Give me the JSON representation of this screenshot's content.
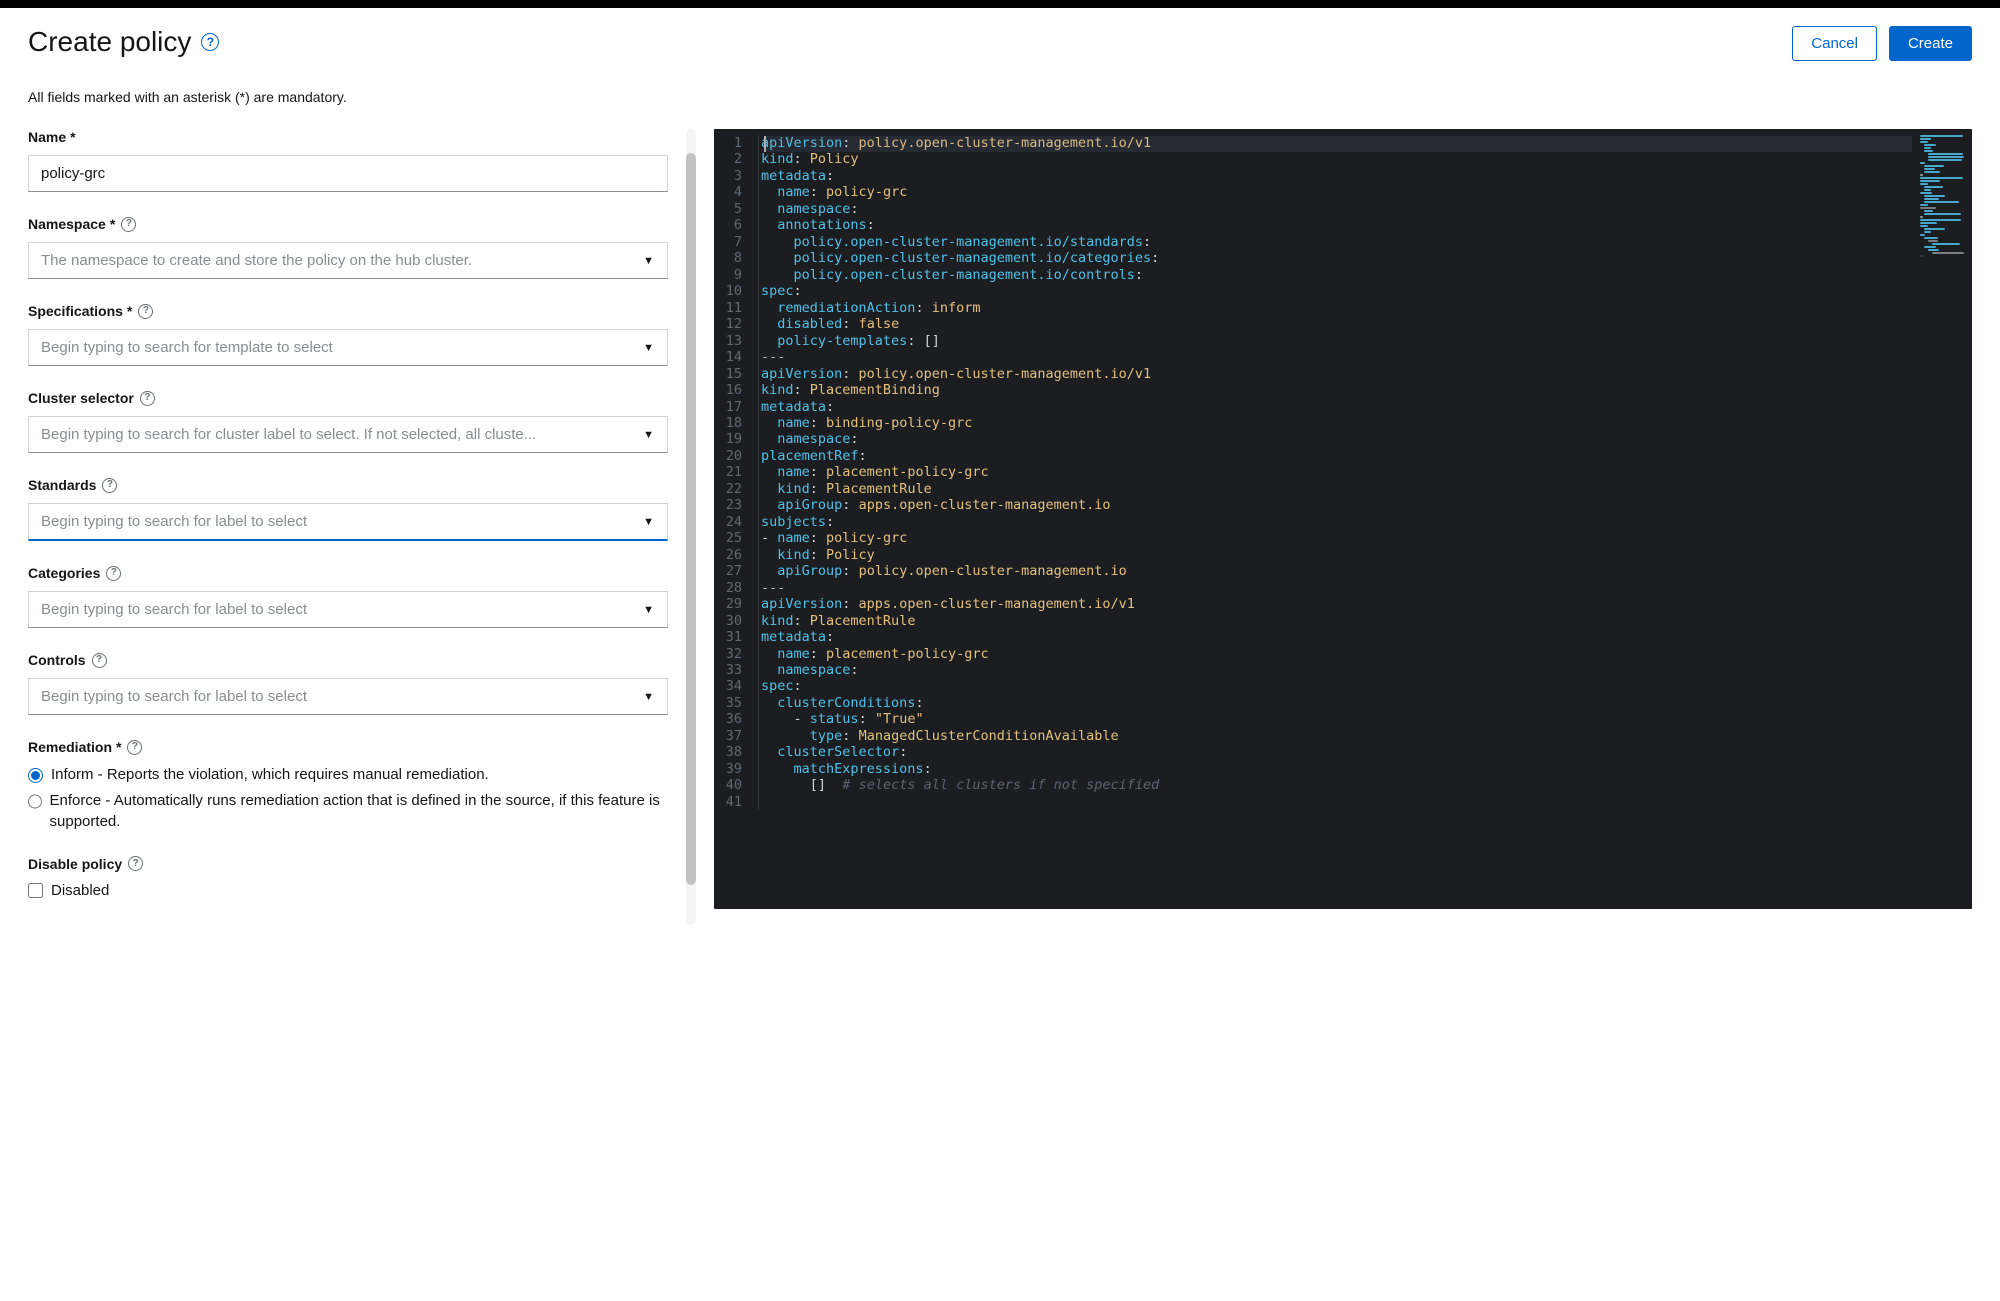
{
  "header": {
    "title": "Create policy",
    "cancel_label": "Cancel",
    "create_label": "Create",
    "mandatory_note": "All fields marked with an asterisk (*) are mandatory."
  },
  "form": {
    "name": {
      "label": "Name",
      "required": true,
      "help": false,
      "value": "policy-grc",
      "placeholder": ""
    },
    "namespace": {
      "label": "Namespace",
      "required": true,
      "help": true,
      "value": "",
      "placeholder": "The namespace to create and store the policy on the hub cluster."
    },
    "specifications": {
      "label": "Specifications",
      "required": true,
      "help": true,
      "value": "",
      "placeholder": "Begin typing to search for template to select"
    },
    "cluster": {
      "label": "Cluster selector",
      "required": false,
      "help": true,
      "value": "",
      "placeholder": "Begin typing to search for cluster label to select. If not selected, all cluste..."
    },
    "standards": {
      "label": "Standards",
      "required": false,
      "help": true,
      "value": "",
      "placeholder": "Begin typing to search for label to select"
    },
    "categories": {
      "label": "Categories",
      "required": false,
      "help": true,
      "value": "",
      "placeholder": "Begin typing to search for label to select"
    },
    "controls": {
      "label": "Controls",
      "required": false,
      "help": true,
      "value": "",
      "placeholder": "Begin typing to search for label to select"
    },
    "remediation": {
      "label": "Remediation",
      "required": true,
      "help": true,
      "options": [
        {
          "id": "inform",
          "label": "Inform - Reports the violation, which requires manual remediation."
        },
        {
          "id": "enforce",
          "label": "Enforce - Automatically runs remediation action that is defined in the source, if this feature is supported."
        }
      ],
      "selected": "inform"
    },
    "disable": {
      "label": "Disable policy",
      "help": true,
      "checkbox_label": "Disabled",
      "checked": false
    }
  },
  "yaml_lines": [
    [
      [
        "apiVersion",
        "key"
      ],
      [
        ": ",
        "punc"
      ],
      [
        "policy.open-cluster-management.io/v1",
        "str"
      ]
    ],
    [
      [
        "kind",
        "key"
      ],
      [
        ": ",
        "punc"
      ],
      [
        "Policy",
        "str"
      ]
    ],
    [
      [
        "metadata",
        "key"
      ],
      [
        ":",
        "punc"
      ]
    ],
    [
      [
        "  ",
        ""
      ],
      [
        "name",
        "key"
      ],
      [
        ": ",
        "punc"
      ],
      [
        "policy-grc",
        "str"
      ]
    ],
    [
      [
        "  ",
        ""
      ],
      [
        "namespace",
        "key"
      ],
      [
        ":",
        "punc"
      ]
    ],
    [
      [
        "  ",
        ""
      ],
      [
        "annotations",
        "key"
      ],
      [
        ":",
        "punc"
      ]
    ],
    [
      [
        "    ",
        ""
      ],
      [
        "policy.open-cluster-management.io/standards",
        "key"
      ],
      [
        ":",
        "punc"
      ]
    ],
    [
      [
        "    ",
        ""
      ],
      [
        "policy.open-cluster-management.io/categories",
        "key"
      ],
      [
        ":",
        "punc"
      ]
    ],
    [
      [
        "    ",
        ""
      ],
      [
        "policy.open-cluster-management.io/controls",
        "key"
      ],
      [
        ":",
        "punc"
      ]
    ],
    [
      [
        "spec",
        "key"
      ],
      [
        ":",
        "punc"
      ]
    ],
    [
      [
        "  ",
        ""
      ],
      [
        "remediationAction",
        "key"
      ],
      [
        ": ",
        "punc"
      ],
      [
        "inform",
        "str"
      ]
    ],
    [
      [
        "  ",
        ""
      ],
      [
        "disabled",
        "key"
      ],
      [
        ": ",
        "punc"
      ],
      [
        "false",
        "bool"
      ]
    ],
    [
      [
        "  ",
        ""
      ],
      [
        "policy-templates",
        "key"
      ],
      [
        ": ",
        "punc"
      ],
      [
        "[]",
        "punc"
      ]
    ],
    [
      [
        "---",
        "sep"
      ]
    ],
    [
      [
        "apiVersion",
        "key"
      ],
      [
        ": ",
        "punc"
      ],
      [
        "policy.open-cluster-management.io/v1",
        "str"
      ]
    ],
    [
      [
        "kind",
        "key"
      ],
      [
        ": ",
        "punc"
      ],
      [
        "PlacementBinding",
        "str"
      ]
    ],
    [
      [
        "metadata",
        "key"
      ],
      [
        ":",
        "punc"
      ]
    ],
    [
      [
        "  ",
        ""
      ],
      [
        "name",
        "key"
      ],
      [
        ": ",
        "punc"
      ],
      [
        "binding-policy-grc",
        "str"
      ]
    ],
    [
      [
        "  ",
        ""
      ],
      [
        "namespace",
        "key"
      ],
      [
        ":",
        "punc"
      ]
    ],
    [
      [
        "placementRef",
        "key"
      ],
      [
        ":",
        "punc"
      ]
    ],
    [
      [
        "  ",
        ""
      ],
      [
        "name",
        "key"
      ],
      [
        ": ",
        "punc"
      ],
      [
        "placement-policy-grc",
        "str"
      ]
    ],
    [
      [
        "  ",
        ""
      ],
      [
        "kind",
        "key"
      ],
      [
        ": ",
        "punc"
      ],
      [
        "PlacementRule",
        "str"
      ]
    ],
    [
      [
        "  ",
        ""
      ],
      [
        "apiGroup",
        "key"
      ],
      [
        ": ",
        "punc"
      ],
      [
        "apps.open-cluster-management.io",
        "str"
      ]
    ],
    [
      [
        "subjects",
        "key"
      ],
      [
        ":",
        "punc"
      ]
    ],
    [
      [
        "- ",
        "dash"
      ],
      [
        "name",
        "key"
      ],
      [
        ": ",
        "punc"
      ],
      [
        "policy-grc",
        "str"
      ]
    ],
    [
      [
        "  ",
        ""
      ],
      [
        "kind",
        "key"
      ],
      [
        ": ",
        "punc"
      ],
      [
        "Policy",
        "str"
      ]
    ],
    [
      [
        "  ",
        ""
      ],
      [
        "apiGroup",
        "key"
      ],
      [
        ": ",
        "punc"
      ],
      [
        "policy.open-cluster-management.io",
        "str"
      ]
    ],
    [
      [
        "---",
        "sep"
      ]
    ],
    [
      [
        "apiVersion",
        "key"
      ],
      [
        ": ",
        "punc"
      ],
      [
        "apps.open-cluster-management.io/v1",
        "str"
      ]
    ],
    [
      [
        "kind",
        "key"
      ],
      [
        ": ",
        "punc"
      ],
      [
        "PlacementRule",
        "str"
      ]
    ],
    [
      [
        "metadata",
        "key"
      ],
      [
        ":",
        "punc"
      ]
    ],
    [
      [
        "  ",
        ""
      ],
      [
        "name",
        "key"
      ],
      [
        ": ",
        "punc"
      ],
      [
        "placement-policy-grc",
        "str"
      ]
    ],
    [
      [
        "  ",
        ""
      ],
      [
        "namespace",
        "key"
      ],
      [
        ":",
        "punc"
      ]
    ],
    [
      [
        "spec",
        "key"
      ],
      [
        ":",
        "punc"
      ]
    ],
    [
      [
        "  ",
        ""
      ],
      [
        "clusterConditions",
        "key"
      ],
      [
        ":",
        "punc"
      ]
    ],
    [
      [
        "    ",
        ""
      ],
      [
        "- ",
        "dash"
      ],
      [
        "status",
        "key"
      ],
      [
        ": ",
        "punc"
      ],
      [
        "\"True\"",
        "str"
      ]
    ],
    [
      [
        "      ",
        ""
      ],
      [
        "type",
        "key"
      ],
      [
        ": ",
        "punc"
      ],
      [
        "ManagedClusterConditionAvailable",
        "str"
      ]
    ],
    [
      [
        "  ",
        ""
      ],
      [
        "clusterSelector",
        "key"
      ],
      [
        ":",
        "punc"
      ]
    ],
    [
      [
        "    ",
        ""
      ],
      [
        "matchExpressions",
        "key"
      ],
      [
        ":",
        "punc"
      ]
    ],
    [
      [
        "      ",
        ""
      ],
      [
        "[]",
        "punc"
      ],
      [
        "  ",
        ""
      ],
      [
        "# selects all clusters if not specified",
        "cmt"
      ]
    ],
    [
      [
        "",
        ""
      ]
    ]
  ]
}
